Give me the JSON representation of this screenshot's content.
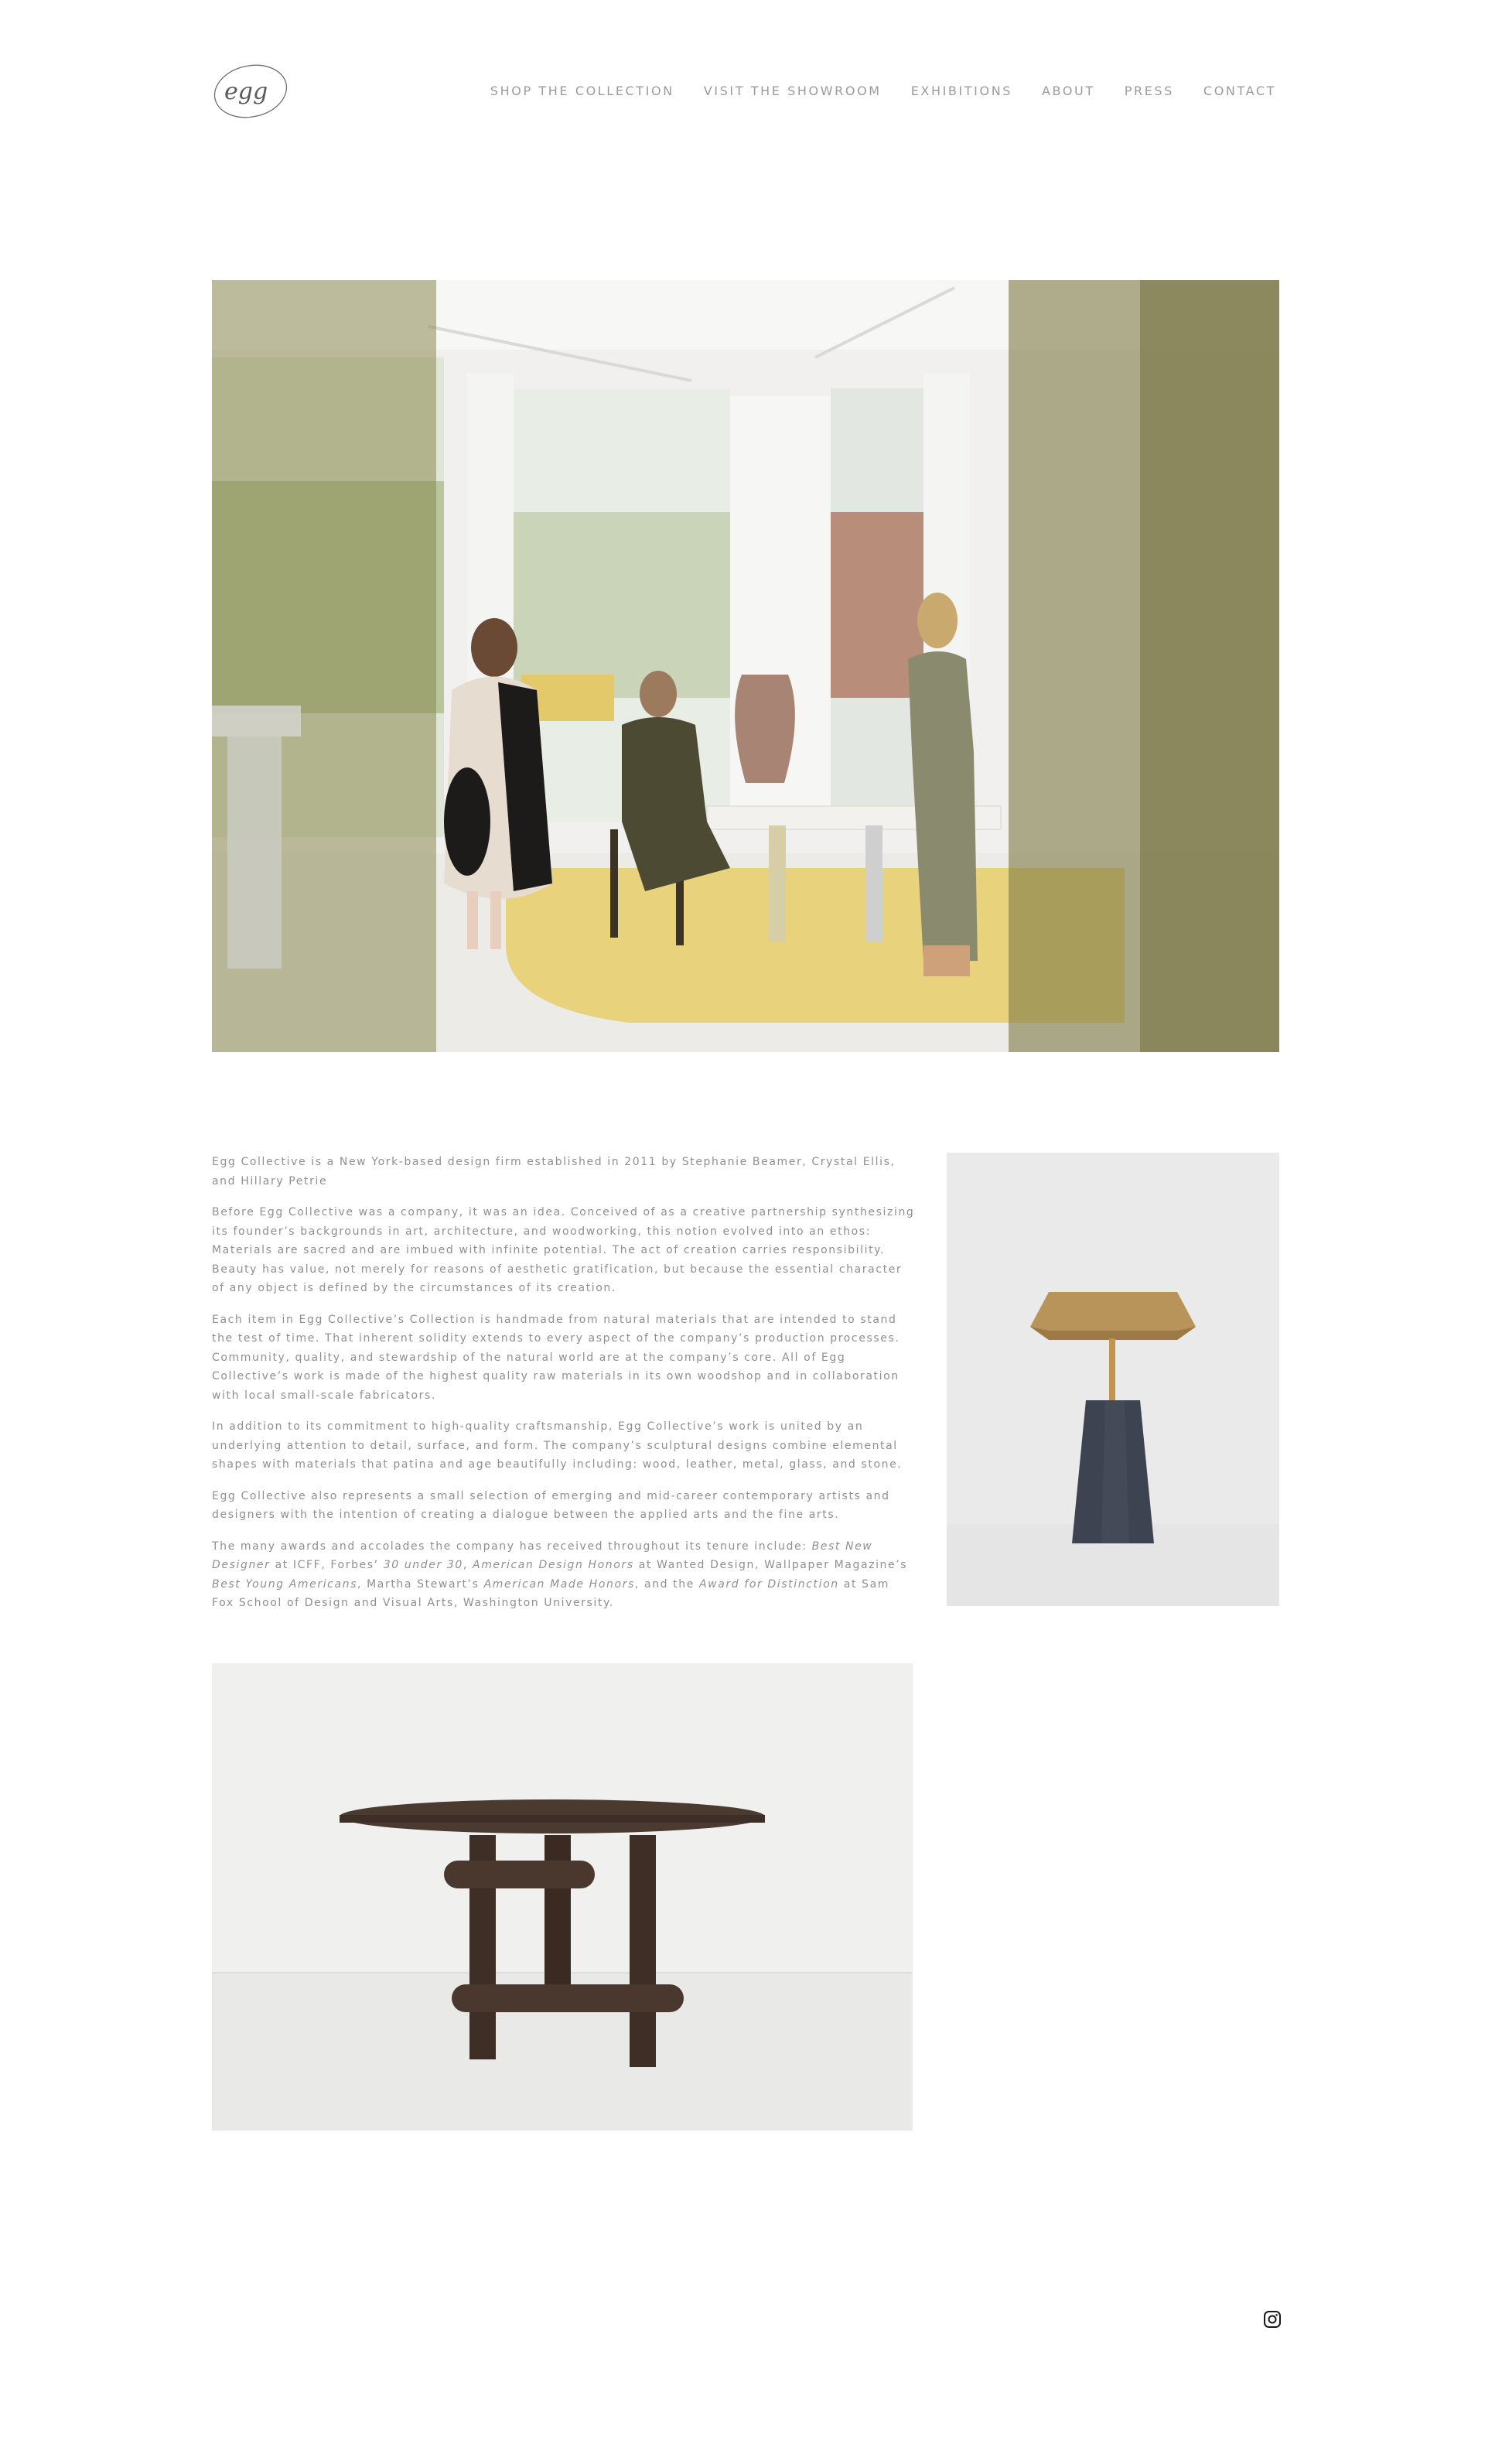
{
  "logo": {
    "text": "egg",
    "alt": "Egg Collective"
  },
  "nav": [
    {
      "label": "SHOP THE COLLECTION"
    },
    {
      "label": "VISIT THE SHOWROOM"
    },
    {
      "label": "EXHIBITIONS"
    },
    {
      "label": "ABOUT"
    },
    {
      "label": "PRESS"
    },
    {
      "label": "CONTACT"
    }
  ],
  "about": {
    "p1": "Egg Collective is a New York-based design firm established in 2011 by Stephanie Beamer, Crystal Ellis, and Hillary Petrie",
    "p2": "Before Egg Collective was a company, it was an idea. Conceived of  as a creative partnership synthesizing its founder’s backgrounds in art, architecture, and woodworking, this notion evolved into an ethos: Materials are sacred and are imbued with infinite potential.  The act of creation carries responsibility. Beauty has value, not merely for reasons of aesthetic gratification, but because the essential character of any object is defined by the circumstances of its creation.",
    "p3": "Each item in Egg Collective’s Collection is handmade from natural materials that are intended to stand the test of time. That inherent solidity extends to every aspect of the company’s production processes. Community, quality, and stewardship of the natural world are at the company’s core. All of Egg Collective’s work is made of the highest quality raw materials in its own woodshop and in collaboration with local small-scale fabricators.",
    "p4": "In addition to its commitment to high-quality craftsmanship, Egg Collective’s work is united by an underlying attention to detail, surface, and form. The company’s sculptural designs combine elemental shapes with materials that patina and age beautifully including: wood, leather, metal, glass, and stone.",
    "p5": "Egg Collective also represents a small selection of emerging and mid-career contemporary artists and designers with the intention of creating a dialogue between the applied arts and the fine arts.",
    "p6": {
      "t1": "The many awards and accolades the company has received throughout its tenure include: ",
      "i1": "Best New Designer",
      "t2": " at ICFF, Forbes’ ",
      "i2": "30 under 30",
      "t3": ", ",
      "i3": "American Design Honors",
      "t4": " at Wanted Design, Wallpaper Magazine’s ",
      "i4": "Best Young Americans",
      "t5": ", Martha Stewart’s ",
      "i5": "American Made Honors",
      "t6": ", and the ",
      "i6": "Award for Distinction",
      "t7": " at Sam Fox School of Design and Visual Arts, Washington University."
    }
  },
  "images": {
    "hero": "showroom-photo",
    "side": "hexagon-side-table-photo",
    "table": "round-dining-table-photo"
  },
  "footer": {
    "social_icon": "instagram-icon"
  },
  "colors": {
    "nav_text": "#9b9b9b",
    "body_text": "#8f8f8f",
    "curtain": "#7d7a45",
    "rug": "#e6cf72"
  }
}
